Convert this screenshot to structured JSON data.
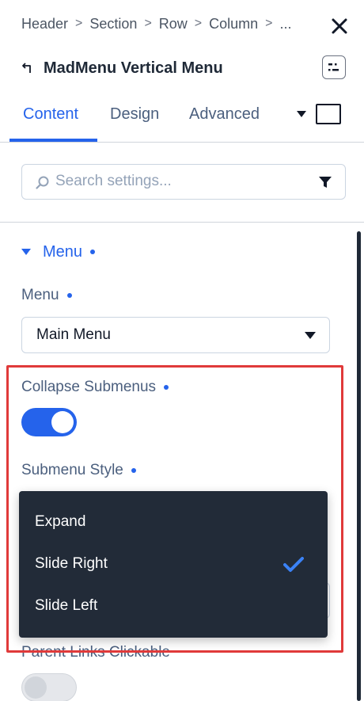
{
  "breadcrumb": {
    "items": [
      "Header",
      "Section",
      "Row",
      "Column"
    ],
    "overflow": "..."
  },
  "header": {
    "title": "MadMenu Vertical Menu"
  },
  "tabs": [
    {
      "label": "Content",
      "active": true
    },
    {
      "label": "Design",
      "active": false
    },
    {
      "label": "Advanced",
      "active": false
    }
  ],
  "search": {
    "placeholder": "Search settings..."
  },
  "section": {
    "title": "Menu"
  },
  "fields": {
    "menu": {
      "label": "Menu",
      "value": "Main Menu"
    },
    "collapse_submenus": {
      "label": "Collapse Submenus",
      "enabled": true
    },
    "submenu_style": {
      "label": "Submenu Style",
      "options": [
        "Expand",
        "Slide Right",
        "Slide Left"
      ],
      "selected": "Slide Right"
    },
    "parent_links_clickable": {
      "label": "Parent Links Clickable",
      "enabled": false
    }
  },
  "colors": {
    "accent": "#2563eb",
    "dropdown_bg": "#222b38",
    "highlight": "#e03a3a"
  }
}
